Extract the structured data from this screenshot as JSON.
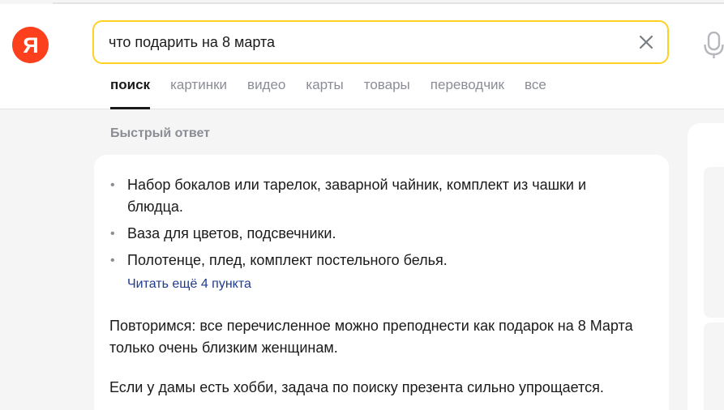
{
  "logo": {
    "letter": "Я",
    "color": "#fc3f1d"
  },
  "search": {
    "value": "что подарить на 8 марта",
    "clear_icon": "close-icon",
    "mic_icon": "microphone-icon",
    "border_color": "#ffd21f"
  },
  "tabs": [
    {
      "label": "поиск",
      "active": true
    },
    {
      "label": "картинки",
      "active": false
    },
    {
      "label": "видео",
      "active": false
    },
    {
      "label": "карты",
      "active": false
    },
    {
      "label": "товары",
      "active": false
    },
    {
      "label": "переводчик",
      "active": false
    },
    {
      "label": "все",
      "active": false
    }
  ],
  "quick_answer": {
    "title": "Быстрый ответ",
    "bullets": [
      "Набор бокалов или тарелок, заварной чайник, комплект из чашки и блюдца.",
      "Ваза для цветов, подсвечники.",
      "Полотенце, плед, комплект постельного белья."
    ],
    "read_more": "Читать ещё 4 пункта",
    "paragraphs": [
      "Повторимся: все перечисленное можно преподнести как подарок на 8 Марта только очень близким женщинам.",
      "Если у дамы есть хобби, задача по поиску презента сильно упрощается."
    ]
  },
  "colors": {
    "muted_text": "#8b8d95",
    "link": "#1f3b8f",
    "page_bg": "#f5f5f6"
  }
}
